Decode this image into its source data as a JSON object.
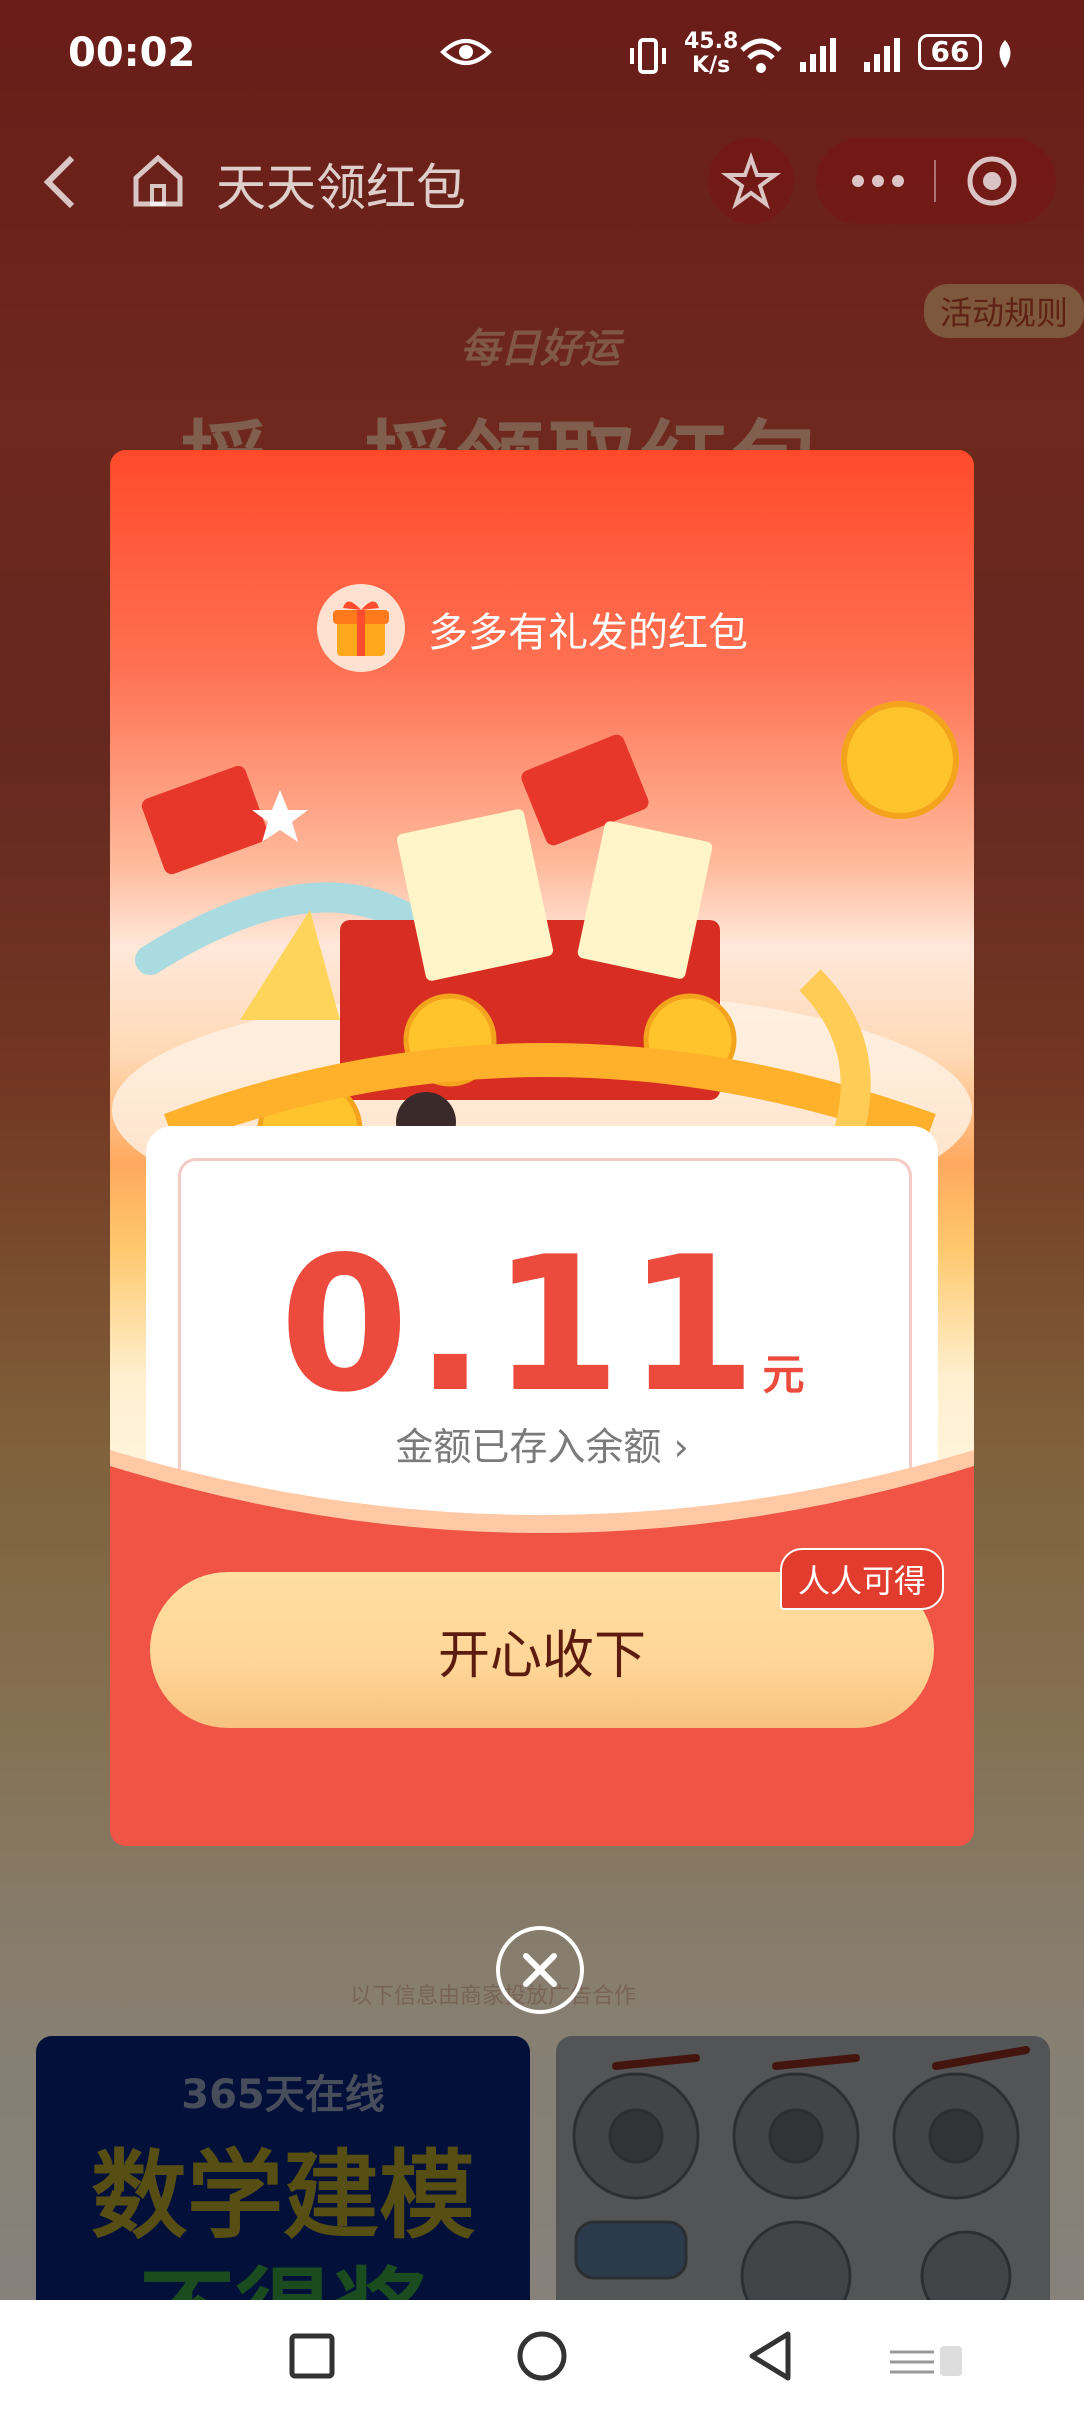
{
  "status_bar": {
    "time": "00:02",
    "speed_value": "45.8",
    "speed_unit": "K/s",
    "battery": "66",
    "icons": [
      "eye-icon",
      "vibrate-icon",
      "wifi-6-icon",
      "signal-icon",
      "signal-icon",
      "battery-icon",
      "leaf-icon"
    ]
  },
  "nav": {
    "title": "天天领红包"
  },
  "background": {
    "rules_label": "活动规则",
    "headline_small": "每日好运",
    "headline_big": "摇一摇领取红包",
    "ad_note": "以下信息由商家投放广告合作"
  },
  "modal": {
    "title": "多多有礼发的红包",
    "amount": "0.11",
    "unit": "元",
    "balance_text": "金额已存入余额 ›",
    "button_label": "开心收下",
    "badge": "人人可得"
  },
  "products": [
    {
      "line1": "365天在线",
      "line2": "数学建模",
      "line3": "不得奖"
    },
    {
      "image": "valves"
    }
  ],
  "colors": {
    "modal_red": "#ef5445",
    "amount_red": "#ec4a3c",
    "button_gold": "#ffd597",
    "button_text": "#5b1c0f"
  }
}
